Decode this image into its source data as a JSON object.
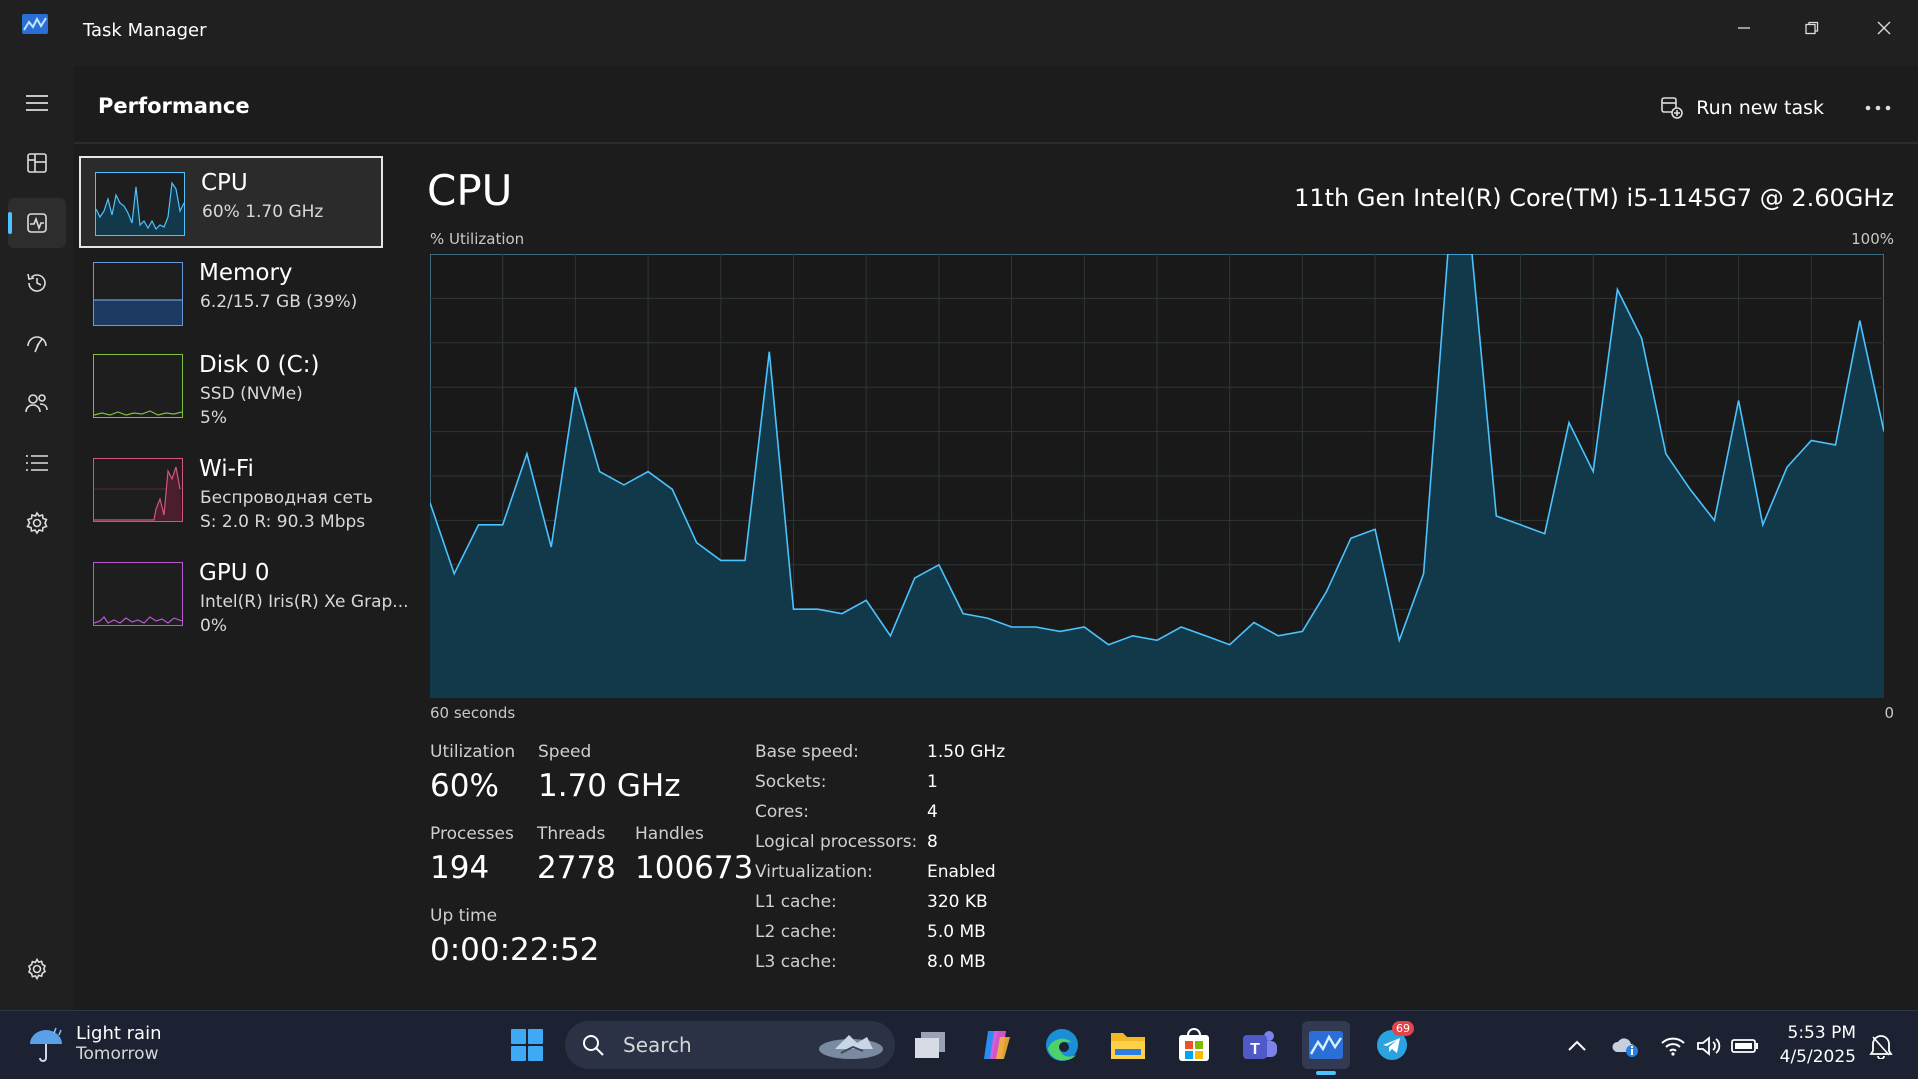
{
  "window": {
    "title": "Task Manager",
    "controls": [
      "minimize-icon",
      "restore-icon",
      "close-icon"
    ]
  },
  "nav": {
    "items": [
      {
        "name": "menu-icon",
        "label": "Menu"
      },
      {
        "name": "processes-icon",
        "label": "Processes"
      },
      {
        "name": "performance-icon",
        "label": "Performance",
        "active": true
      },
      {
        "name": "app-history-icon",
        "label": "App history"
      },
      {
        "name": "startup-apps-icon",
        "label": "Startup apps"
      },
      {
        "name": "users-icon",
        "label": "Users"
      },
      {
        "name": "details-icon",
        "label": "Details"
      },
      {
        "name": "services-icon",
        "label": "Services"
      }
    ],
    "settings_icon": "gear-icon"
  },
  "header": {
    "title": "Performance",
    "run_new_task": "Run new task",
    "more_icon": "more-icon"
  },
  "sidebar": {
    "items": [
      {
        "name": "CPU",
        "sub1": "60%  1.70 GHz",
        "sub2": "",
        "color": "#4cc2ff"
      },
      {
        "name": "Memory",
        "sub1": "6.2/15.7 GB (39%)",
        "sub2": "",
        "color": "#6a98d6"
      },
      {
        "name": "Disk 0 (C:)",
        "sub1": "SSD (NVMe)",
        "sub2": "5%",
        "color": "#7fbf3f"
      },
      {
        "name": "Wi-Fi",
        "sub1": "Беспроводная сеть",
        "sub2": "S: 2.0  R: 90.3 Mbps",
        "color": "#d4557a"
      },
      {
        "name": "GPU 0",
        "sub1": "Intel(R) Iris(R) Xe Grap...",
        "sub2": "0%",
        "color": "#b65ad1"
      }
    ]
  },
  "main": {
    "title": "CPU",
    "cpu_model": "11th Gen Intel(R) Core(TM) i5-1145G7 @ 2.60GHz",
    "axis_left": "% Utilization",
    "axis_right": "100%",
    "axis_bottom_left": "60 seconds",
    "axis_bottom_right": "0"
  },
  "chart_data": {
    "type": "area",
    "x": [
      60,
      59,
      58,
      57,
      56,
      55,
      54,
      53,
      52,
      51,
      50,
      49,
      48,
      47,
      46,
      45,
      44,
      43,
      42,
      41,
      40,
      39,
      38,
      37,
      36,
      35,
      34,
      33,
      32,
      31,
      30,
      29,
      28,
      27,
      26,
      25,
      24,
      23,
      22,
      21,
      20,
      19,
      18,
      17,
      16,
      15,
      14,
      13,
      12,
      11,
      10,
      9,
      8,
      7,
      6,
      5,
      4,
      3,
      2,
      1,
      0
    ],
    "series": [
      {
        "values": [
          44,
          28,
          39,
          39,
          55,
          34,
          70,
          51,
          48,
          51,
          47,
          35,
          31,
          31,
          78,
          20,
          20,
          19,
          22,
          14,
          27,
          30,
          19,
          18,
          16,
          16,
          15,
          16,
          12,
          14,
          13,
          16,
          14,
          12,
          17,
          14,
          15,
          24,
          36,
          38,
          13,
          28,
          100,
          100,
          41,
          39,
          37,
          62,
          51,
          92,
          81,
          55,
          47,
          40,
          67,
          39,
          52,
          58,
          57,
          85,
          60
        ]
      }
    ],
    "ylim": [
      0,
      100
    ],
    "color": "#4cc2ff",
    "fill": "#12394a",
    "grid": true
  },
  "stats": {
    "utilization_label": "Utilization",
    "utilization_value": "60%",
    "speed_label": "Speed",
    "speed_value": "1.70 GHz",
    "processes_label": "Processes",
    "processes_value": "194",
    "threads_label": "Threads",
    "threads_value": "2778",
    "handles_label": "Handles",
    "handles_value": "100673",
    "uptime_label": "Up time",
    "uptime_value": "0:00:22:52"
  },
  "specs": [
    {
      "label": "Base speed:",
      "value": "1.50 GHz"
    },
    {
      "label": "Sockets:",
      "value": "1"
    },
    {
      "label": "Cores:",
      "value": "4"
    },
    {
      "label": "Logical processors:",
      "value": "8"
    },
    {
      "label": "Virtualization:",
      "value": "Enabled"
    },
    {
      "label": "L1 cache:",
      "value": "320 KB"
    },
    {
      "label": "L2 cache:",
      "value": "5.0 MB"
    },
    {
      "label": "L3 cache:",
      "value": "8.0 MB"
    }
  ],
  "taskbar": {
    "weather_line1": "Light rain",
    "weather_line2": "Tomorrow",
    "search_placeholder": "Search",
    "time": "5:53 PM",
    "date": "4/5/2025",
    "telegram_badge": "69"
  }
}
